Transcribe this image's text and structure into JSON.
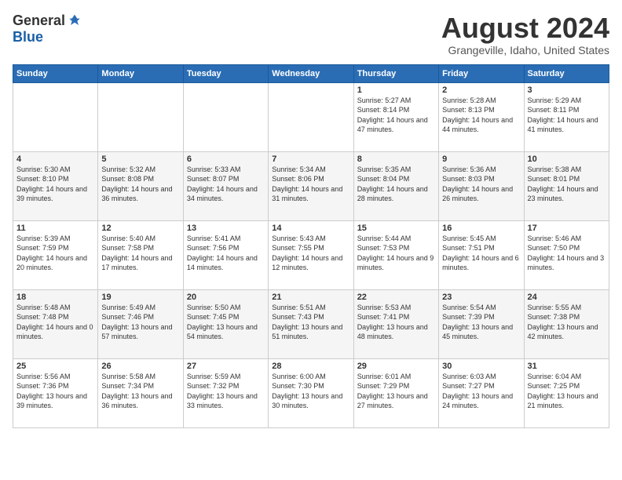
{
  "logo": {
    "general": "General",
    "blue": "Blue"
  },
  "title": "August 2024",
  "location": "Grangeville, Idaho, United States",
  "days_of_week": [
    "Sunday",
    "Monday",
    "Tuesday",
    "Wednesday",
    "Thursday",
    "Friday",
    "Saturday"
  ],
  "weeks": [
    [
      {
        "day": "",
        "sunrise": "",
        "sunset": "",
        "daylight": ""
      },
      {
        "day": "",
        "sunrise": "",
        "sunset": "",
        "daylight": ""
      },
      {
        "day": "",
        "sunrise": "",
        "sunset": "",
        "daylight": ""
      },
      {
        "day": "",
        "sunrise": "",
        "sunset": "",
        "daylight": ""
      },
      {
        "day": "1",
        "sunrise": "Sunrise: 5:27 AM",
        "sunset": "Sunset: 8:14 PM",
        "daylight": "Daylight: 14 hours and 47 minutes."
      },
      {
        "day": "2",
        "sunrise": "Sunrise: 5:28 AM",
        "sunset": "Sunset: 8:13 PM",
        "daylight": "Daylight: 14 hours and 44 minutes."
      },
      {
        "day": "3",
        "sunrise": "Sunrise: 5:29 AM",
        "sunset": "Sunset: 8:11 PM",
        "daylight": "Daylight: 14 hours and 41 minutes."
      }
    ],
    [
      {
        "day": "4",
        "sunrise": "Sunrise: 5:30 AM",
        "sunset": "Sunset: 8:10 PM",
        "daylight": "Daylight: 14 hours and 39 minutes."
      },
      {
        "day": "5",
        "sunrise": "Sunrise: 5:32 AM",
        "sunset": "Sunset: 8:08 PM",
        "daylight": "Daylight: 14 hours and 36 minutes."
      },
      {
        "day": "6",
        "sunrise": "Sunrise: 5:33 AM",
        "sunset": "Sunset: 8:07 PM",
        "daylight": "Daylight: 14 hours and 34 minutes."
      },
      {
        "day": "7",
        "sunrise": "Sunrise: 5:34 AM",
        "sunset": "Sunset: 8:06 PM",
        "daylight": "Daylight: 14 hours and 31 minutes."
      },
      {
        "day": "8",
        "sunrise": "Sunrise: 5:35 AM",
        "sunset": "Sunset: 8:04 PM",
        "daylight": "Daylight: 14 hours and 28 minutes."
      },
      {
        "day": "9",
        "sunrise": "Sunrise: 5:36 AM",
        "sunset": "Sunset: 8:03 PM",
        "daylight": "Daylight: 14 hours and 26 minutes."
      },
      {
        "day": "10",
        "sunrise": "Sunrise: 5:38 AM",
        "sunset": "Sunset: 8:01 PM",
        "daylight": "Daylight: 14 hours and 23 minutes."
      }
    ],
    [
      {
        "day": "11",
        "sunrise": "Sunrise: 5:39 AM",
        "sunset": "Sunset: 7:59 PM",
        "daylight": "Daylight: 14 hours and 20 minutes."
      },
      {
        "day": "12",
        "sunrise": "Sunrise: 5:40 AM",
        "sunset": "Sunset: 7:58 PM",
        "daylight": "Daylight: 14 hours and 17 minutes."
      },
      {
        "day": "13",
        "sunrise": "Sunrise: 5:41 AM",
        "sunset": "Sunset: 7:56 PM",
        "daylight": "Daylight: 14 hours and 14 minutes."
      },
      {
        "day": "14",
        "sunrise": "Sunrise: 5:43 AM",
        "sunset": "Sunset: 7:55 PM",
        "daylight": "Daylight: 14 hours and 12 minutes."
      },
      {
        "day": "15",
        "sunrise": "Sunrise: 5:44 AM",
        "sunset": "Sunset: 7:53 PM",
        "daylight": "Daylight: 14 hours and 9 minutes."
      },
      {
        "day": "16",
        "sunrise": "Sunrise: 5:45 AM",
        "sunset": "Sunset: 7:51 PM",
        "daylight": "Daylight: 14 hours and 6 minutes."
      },
      {
        "day": "17",
        "sunrise": "Sunrise: 5:46 AM",
        "sunset": "Sunset: 7:50 PM",
        "daylight": "Daylight: 14 hours and 3 minutes."
      }
    ],
    [
      {
        "day": "18",
        "sunrise": "Sunrise: 5:48 AM",
        "sunset": "Sunset: 7:48 PM",
        "daylight": "Daylight: 14 hours and 0 minutes."
      },
      {
        "day": "19",
        "sunrise": "Sunrise: 5:49 AM",
        "sunset": "Sunset: 7:46 PM",
        "daylight": "Daylight: 13 hours and 57 minutes."
      },
      {
        "day": "20",
        "sunrise": "Sunrise: 5:50 AM",
        "sunset": "Sunset: 7:45 PM",
        "daylight": "Daylight: 13 hours and 54 minutes."
      },
      {
        "day": "21",
        "sunrise": "Sunrise: 5:51 AM",
        "sunset": "Sunset: 7:43 PM",
        "daylight": "Daylight: 13 hours and 51 minutes."
      },
      {
        "day": "22",
        "sunrise": "Sunrise: 5:53 AM",
        "sunset": "Sunset: 7:41 PM",
        "daylight": "Daylight: 13 hours and 48 minutes."
      },
      {
        "day": "23",
        "sunrise": "Sunrise: 5:54 AM",
        "sunset": "Sunset: 7:39 PM",
        "daylight": "Daylight: 13 hours and 45 minutes."
      },
      {
        "day": "24",
        "sunrise": "Sunrise: 5:55 AM",
        "sunset": "Sunset: 7:38 PM",
        "daylight": "Daylight: 13 hours and 42 minutes."
      }
    ],
    [
      {
        "day": "25",
        "sunrise": "Sunrise: 5:56 AM",
        "sunset": "Sunset: 7:36 PM",
        "daylight": "Daylight: 13 hours and 39 minutes."
      },
      {
        "day": "26",
        "sunrise": "Sunrise: 5:58 AM",
        "sunset": "Sunset: 7:34 PM",
        "daylight": "Daylight: 13 hours and 36 minutes."
      },
      {
        "day": "27",
        "sunrise": "Sunrise: 5:59 AM",
        "sunset": "Sunset: 7:32 PM",
        "daylight": "Daylight: 13 hours and 33 minutes."
      },
      {
        "day": "28",
        "sunrise": "Sunrise: 6:00 AM",
        "sunset": "Sunset: 7:30 PM",
        "daylight": "Daylight: 13 hours and 30 minutes."
      },
      {
        "day": "29",
        "sunrise": "Sunrise: 6:01 AM",
        "sunset": "Sunset: 7:29 PM",
        "daylight": "Daylight: 13 hours and 27 minutes."
      },
      {
        "day": "30",
        "sunrise": "Sunrise: 6:03 AM",
        "sunset": "Sunset: 7:27 PM",
        "daylight": "Daylight: 13 hours and 24 minutes."
      },
      {
        "day": "31",
        "sunrise": "Sunrise: 6:04 AM",
        "sunset": "Sunset: 7:25 PM",
        "daylight": "Daylight: 13 hours and 21 minutes."
      }
    ]
  ]
}
